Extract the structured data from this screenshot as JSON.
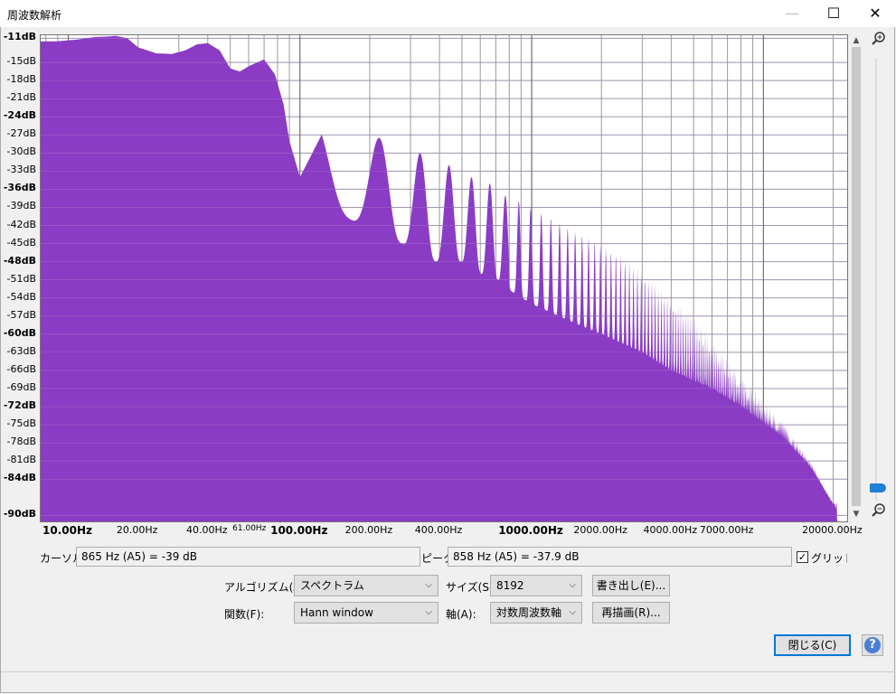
{
  "window": {
    "title": "周波数解析",
    "min_icon": "minimize-icon",
    "max_icon": "maximize-icon",
    "close_icon": "close-icon"
  },
  "chart_data": {
    "type": "area",
    "title": "",
    "xlabel": "",
    "ylabel": "",
    "xscale": "log",
    "xlim": [
      7.6,
      23000
    ],
    "ylim": [
      -91,
      -10.5
    ],
    "grid": true,
    "fill_color": "#8a3cc4",
    "yticks": [
      "-11dB",
      "-15dB",
      "-18dB",
      "-21dB",
      "-24dB",
      "-27dB",
      "-30dB",
      "-33dB",
      "-36dB",
      "-39dB",
      "-42dB",
      "-45dB",
      "-48dB",
      "-51dB",
      "-54dB",
      "-57dB",
      "-60dB",
      "-63dB",
      "-66dB",
      "-69dB",
      "-72dB",
      "-75dB",
      "-78dB",
      "-81dB",
      "-84dB",
      "-90dB"
    ],
    "ytick_values": [
      -11,
      -15,
      -18,
      -21,
      -24,
      -27,
      -30,
      -33,
      -36,
      -39,
      -42,
      -45,
      -48,
      -51,
      -54,
      -57,
      -60,
      -63,
      -66,
      -69,
      -72,
      -75,
      -78,
      -81,
      -84,
      -90
    ],
    "ytick_bold": [
      "-11dB",
      "-24dB",
      "-36dB",
      "-48dB",
      "-60dB",
      "-72dB",
      "-84dB",
      "-90dB"
    ],
    "xticks": [
      {
        "label": "10.00Hz",
        "value": 10,
        "bold": true
      },
      {
        "label": "20.00Hz",
        "value": 20
      },
      {
        "label": "40.00Hz",
        "value": 40
      },
      {
        "label": "61.00Hz",
        "value": 61
      },
      {
        "label": "100.00Hz",
        "value": 100,
        "bold": true
      },
      {
        "label": "200.00Hz",
        "value": 200
      },
      {
        "label": "400.00Hz",
        "value": 400
      },
      {
        "label": "1000.00Hz",
        "value": 1000,
        "bold": true
      },
      {
        "label": "2000.00Hz",
        "value": 2000
      },
      {
        "label": "4000.00Hz",
        "value": 4000
      },
      {
        "label": "7000.00Hz",
        "value": 7000
      },
      {
        "label": "20000.00Hz",
        "value": 20000
      }
    ],
    "envelope": {
      "x": [
        7.6,
        9,
        11,
        13,
        15,
        16,
        18,
        20,
        24,
        28,
        32,
        36,
        40,
        45,
        50,
        55,
        61,
        70,
        78,
        85,
        90,
        100
      ],
      "y": [
        -11.5,
        -11.5,
        -11.2,
        -10.8,
        -10.7,
        -10.6,
        -11.0,
        -12.5,
        -13.5,
        -13.6,
        -13.0,
        -12.0,
        -11.8,
        -13.0,
        -16.0,
        -16.5,
        -15.5,
        -14.5,
        -17.0,
        -22.0,
        -28.0,
        -34.0
      ]
    },
    "harmonics": {
      "fundamental": 110,
      "peaks": [
        {
          "x": 110,
          "y": -23.0
        },
        {
          "x": 220,
          "y": -27.5
        },
        {
          "x": 330,
          "y": -30.0
        },
        {
          "x": 440,
          "y": -32.0
        },
        {
          "x": 550,
          "y": -34.0
        },
        {
          "x": 660,
          "y": -35.0
        },
        {
          "x": 770,
          "y": -37.0
        },
        {
          "x": 880,
          "y": -37.9
        },
        {
          "x": 1100,
          "y": -40.0
        },
        {
          "x": 1320,
          "y": -41.5
        },
        {
          "x": 1540,
          "y": -43.0
        },
        {
          "x": 1760,
          "y": -44.0
        },
        {
          "x": 2200,
          "y": -46.0
        },
        {
          "x": 2640,
          "y": -48.0
        },
        {
          "x": 3080,
          "y": -50.0
        },
        {
          "x": 3520,
          "y": -52.0
        },
        {
          "x": 4400,
          "y": -55.0
        },
        {
          "x": 5280,
          "y": -58.0
        },
        {
          "x": 6160,
          "y": -61.0
        },
        {
          "x": 7040,
          "y": -64.0
        },
        {
          "x": 8800,
          "y": -68.0
        },
        {
          "x": 10560,
          "y": -72.0
        },
        {
          "x": 12320,
          "y": -75.0
        },
        {
          "x": 14080,
          "y": -78.0
        },
        {
          "x": 16500,
          "y": -82.0
        },
        {
          "x": 18500,
          "y": -86.0
        },
        {
          "x": 20500,
          "y": -89.0
        }
      ],
      "troughs": [
        {
          "x": 105,
          "y": -36.0
        },
        {
          "x": 165,
          "y": -41.0
        },
        {
          "x": 275,
          "y": -45.0
        },
        {
          "x": 385,
          "y": -48.0
        },
        {
          "x": 495,
          "y": -48.0
        },
        {
          "x": 605,
          "y": -50.0
        },
        {
          "x": 715,
          "y": -51.0
        },
        {
          "x": 825,
          "y": -53.0
        },
        {
          "x": 1000,
          "y": -55.0
        },
        {
          "x": 1500,
          "y": -58.0
        },
        {
          "x": 2000,
          "y": -60.0
        },
        {
          "x": 3000,
          "y": -63.0
        },
        {
          "x": 4000,
          "y": -66.0
        },
        {
          "x": 6000,
          "y": -69.0
        },
        {
          "x": 8000,
          "y": -72.0
        },
        {
          "x": 12000,
          "y": -77.0
        },
        {
          "x": 16000,
          "y": -82.0
        },
        {
          "x": 20000,
          "y": -88.0
        }
      ]
    }
  },
  "controls": {
    "cursor_label": "カーソル:",
    "cursor_value": "865 Hz (A5) = -39 dB",
    "peak_label": "ピーク:",
    "peak_value": "858 Hz (A5) = -37.9 dB",
    "grid_label": "グリッド(G)",
    "grid_checked": true,
    "algorithm_label": "アルゴリズム(A):",
    "algorithm_value": "スペクトラム",
    "size_label": "サイズ(S):",
    "size_value": "8192",
    "export_button": "書き出し(E)...",
    "function_label": "関数(F):",
    "function_value": "Hann window",
    "axis_label": "軸(A):",
    "axis_value": "対数周波数軸",
    "replot_button": "再描画(R)...",
    "close_button": "閉じる(C)",
    "help_icon": "help-icon",
    "zoom_in_icon": "zoom-in-icon",
    "zoom_out_icon": "zoom-out-icon"
  }
}
